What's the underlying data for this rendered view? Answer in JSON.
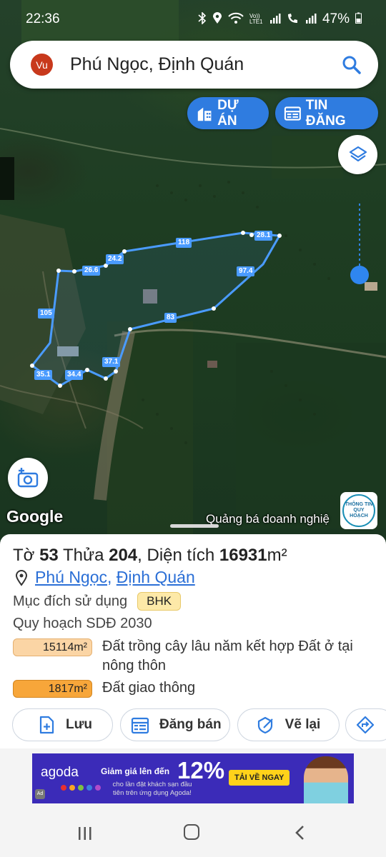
{
  "status_bar": {
    "time": "22:36",
    "icons": [
      "bluetooth-icon",
      "location-icon",
      "wifi-icon",
      "volte-icon",
      "signal-icon",
      "wifi-calling-icon",
      "signal-2-icon"
    ],
    "volte_label": "Vo)) LTE1",
    "battery_percent": "47%"
  },
  "search": {
    "avatar_initials": "Vu",
    "query": "Phú Ngọc, Định Quán"
  },
  "map_buttons": {
    "du_an": "DỰ ÁN",
    "tin_dang": "TIN ĐĂNG"
  },
  "map": {
    "parcel_edges": [
      "118",
      "28.1",
      "24.2",
      "26.6",
      "97.4",
      "105",
      "83",
      "37.1",
      "35.1",
      "34.4"
    ],
    "attribution": "Google",
    "promo": "Quảng bá doanh nghiệ",
    "planning_badge": [
      "THÔNG TIN",
      "QUY HOẠCH"
    ],
    "polygon_color": "#4a9bff",
    "marker_color": "#2f86f0"
  },
  "parcel": {
    "to_label": "Tờ",
    "to_number": "53",
    "thua_label": "Thửa",
    "thua_number": "204",
    "area_label": ", Diện tích",
    "area_value": "16931",
    "area_unit": "m²",
    "location_ward": "Phú Ngọc",
    "location_sep": ",",
    "location_district": "Định Quán",
    "usage_label": "Mục đích sử dụng",
    "usage_code": "BHK",
    "plan_label": "Quy hoạch SDĐ 2030",
    "plans": [
      {
        "area": "15114m²",
        "desc": "Đất trồng cây lâu năm kết hợp Đất ở tại nông thôn",
        "color": "#fbd5a5"
      },
      {
        "area": "1817m²",
        "desc": "Đất giao thông",
        "color": "#f7a63a"
      }
    ]
  },
  "actions": {
    "luu": "Lưu",
    "dang_ban": "Đăng bán",
    "ve_lai": "Vẽ lại"
  },
  "ad": {
    "brand": "agoda",
    "headline": "Giảm giá lên đến",
    "percent": "12%",
    "sub": "cho lần đặt khách sạn đầu tiên trên ứng dụng Agoda!",
    "cta": "TẢI VỀ NGAY",
    "ai_badge": "Ad",
    "dot_colors": [
      "#e8302f",
      "#f6a623",
      "#7cc242",
      "#3a7ee0",
      "#b14ac9"
    ]
  }
}
